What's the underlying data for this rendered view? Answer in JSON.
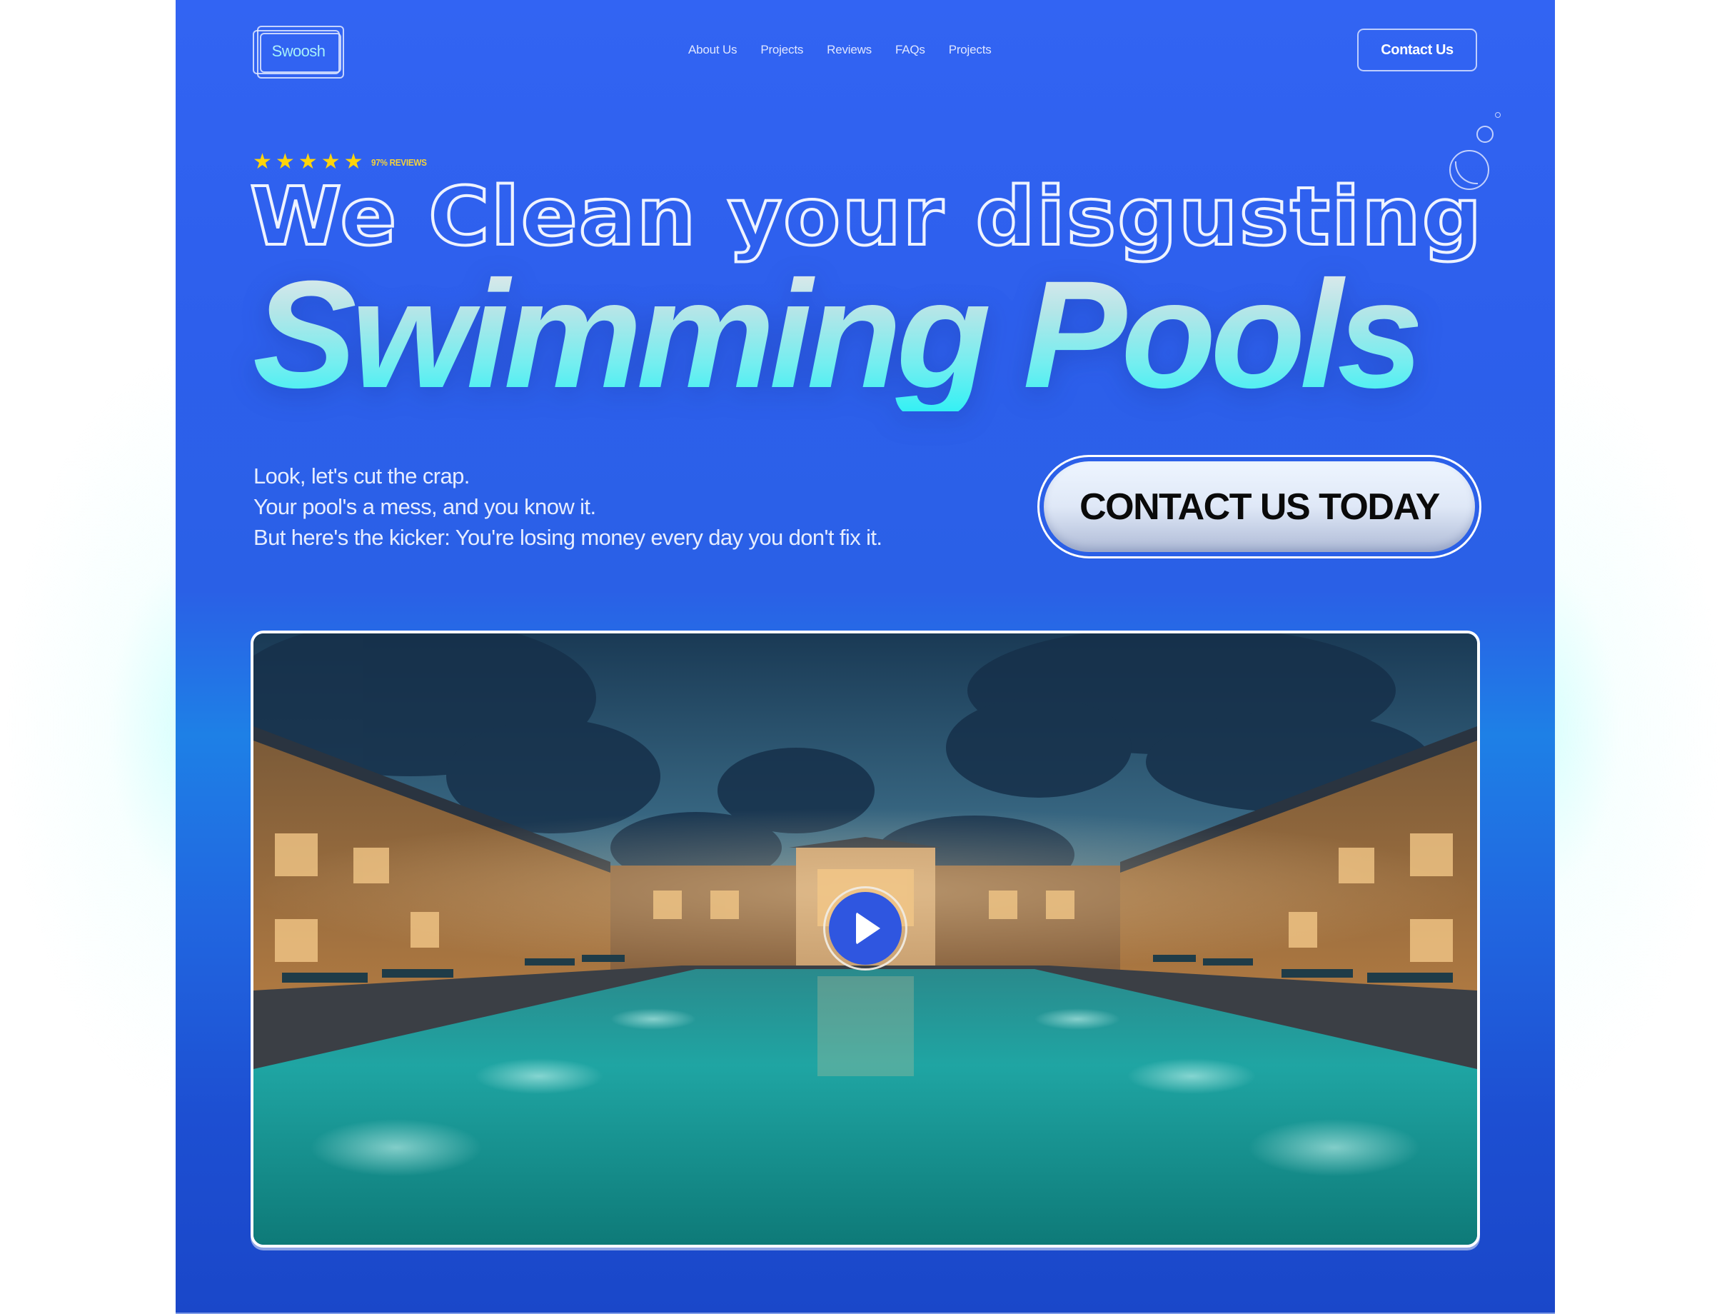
{
  "header": {
    "logo_text": "Swoosh",
    "nav_items": [
      {
        "label": "About Us"
      },
      {
        "label": "Projects"
      },
      {
        "label": "Reviews"
      },
      {
        "label": "FAQs"
      },
      {
        "label": "Projects"
      }
    ],
    "contact_button": "Contact Us"
  },
  "hero": {
    "rating": {
      "stars": 5,
      "max_stars": 5,
      "star_glyph": "★",
      "label": "97% REVIEWS"
    },
    "headline_line1": "We Clean your disgusting",
    "headline_line2": "Swimming Pools",
    "tagline": [
      "Look, let's cut the crap.",
      "Your pool's a mess, and you know it.",
      "But here's the kicker: You're losing money every day you don't fix it."
    ],
    "cta_label": "CONTACT US TODAY"
  },
  "video": {
    "thumbnail_alt": "Luxury resort pool at dusk",
    "play_icon": "play-icon"
  },
  "colors": {
    "brand_blue": "#2f62ee",
    "accent_cyan": "#35f0f4",
    "star_yellow": "#ffd40a",
    "play_blue": "#2f56e0"
  }
}
